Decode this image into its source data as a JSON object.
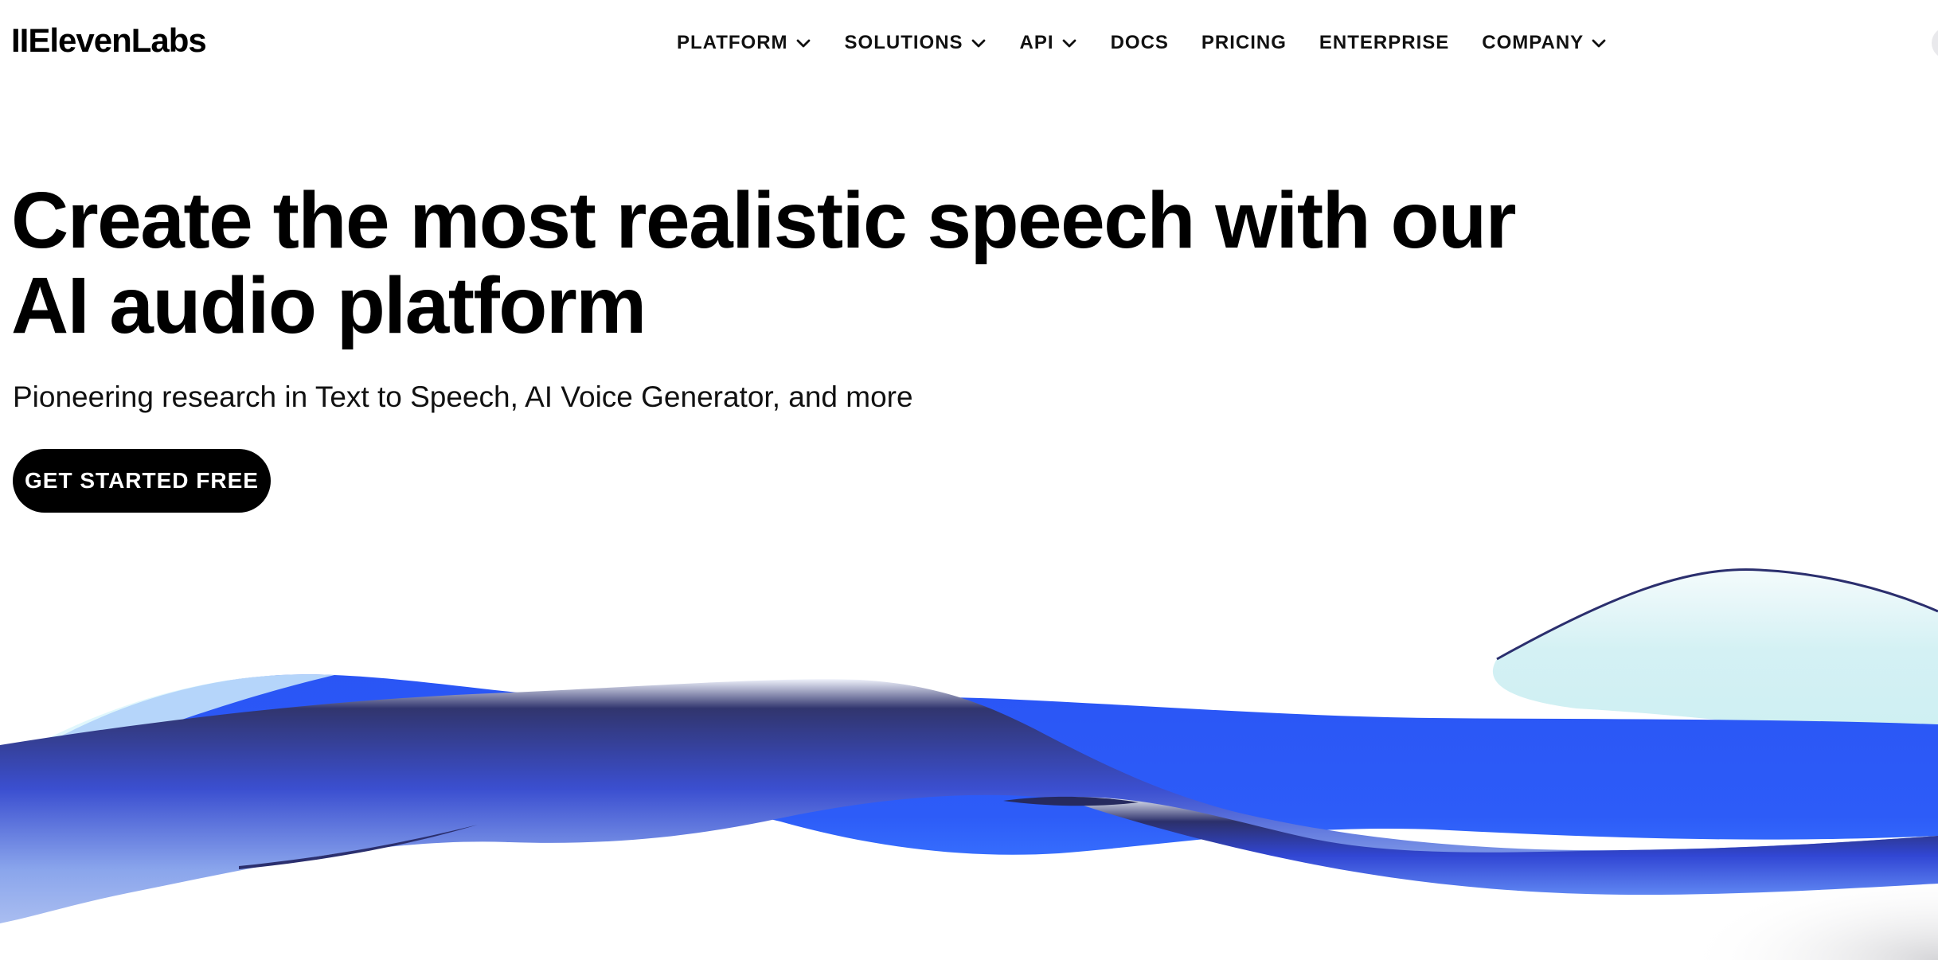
{
  "header": {
    "logo": "IIElevenLabs",
    "nav": [
      {
        "label": "PLATFORM",
        "has_dropdown": true
      },
      {
        "label": "SOLUTIONS",
        "has_dropdown": true
      },
      {
        "label": "API",
        "has_dropdown": true
      },
      {
        "label": "DOCS",
        "has_dropdown": false
      },
      {
        "label": "PRICING",
        "has_dropdown": false
      },
      {
        "label": "ENTERPRISE",
        "has_dropdown": false
      },
      {
        "label": "COMPANY",
        "has_dropdown": true
      }
    ]
  },
  "hero": {
    "title_line1": "Create the most realistic speech with our",
    "title_line2": "AI audio platform",
    "subtitle": "Pioneering research in Text to Speech, AI Voice Generator, and more",
    "cta_label": "GET STARTED FREE"
  },
  "icons": {
    "dropdown": "chevron-down-icon"
  },
  "colors": {
    "background": "#ffffff",
    "text": "#000000",
    "cta_background": "#000000",
    "cta_text": "#ffffff",
    "wave_blue": "#2a55f5",
    "wave_navy": "#2b2f6e",
    "wave_light_blue": "#a7bdf0",
    "wave_cyan": "#d6f3f5"
  }
}
